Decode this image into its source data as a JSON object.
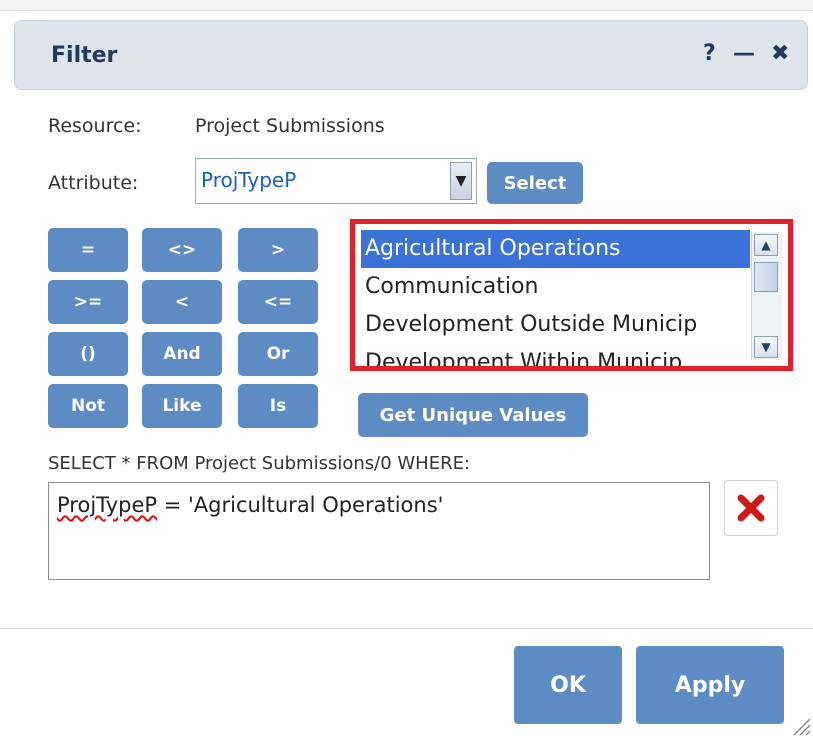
{
  "window": {
    "title": "Filter",
    "help_label": "?",
    "minimize_label": "—",
    "close_label": "✖"
  },
  "resource": {
    "label": "Resource:",
    "value": "Project Submissions"
  },
  "attribute": {
    "label": "Attribute:",
    "value": "ProjTypeP",
    "select_button": "Select"
  },
  "operators": [
    "=",
    "<>",
    ">",
    ">=",
    "<",
    "<=",
    "()",
    "And",
    "Or",
    "Not",
    "Like",
    "Is"
  ],
  "values_list": {
    "items": [
      "Agricultural Operations",
      "Communication",
      "Development Outside Municip",
      "Development Within Municip"
    ],
    "selected_index": 0
  },
  "get_unique_values_label": "Get Unique Values",
  "query": {
    "label": "SELECT * FROM Project Submissions/0 WHERE:",
    "field_name": "ProjTypeP",
    "rest": " = 'Agricultural Operations'"
  },
  "footer": {
    "ok_label": "OK",
    "apply_label": "Apply"
  },
  "colors": {
    "accent": "#5c8cc3",
    "title_bar": "#dde4ec",
    "highlight": "#e0202a",
    "selection": "#3a72d8"
  }
}
